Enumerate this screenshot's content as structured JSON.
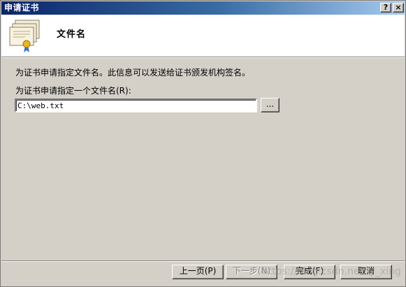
{
  "window": {
    "title": "申请证书",
    "help_label": "?",
    "close_label": "×"
  },
  "header": {
    "title": "文件名",
    "icon": "certificate-icon"
  },
  "content": {
    "description": "为证书申请指定文件名。此信息可以发送给证书颁发机构签名。",
    "field_label": "为证书申请指定一个文件名(R):",
    "filename_value": "C:\\web.txt",
    "browse_label": "..."
  },
  "footer": {
    "back_label": "上一页(P)",
    "next_label": "下一步(N)",
    "finish_label": "完成(F)",
    "cancel_label": "取消"
  },
  "watermark": "https://blog.csdn.net/ly_xing"
}
